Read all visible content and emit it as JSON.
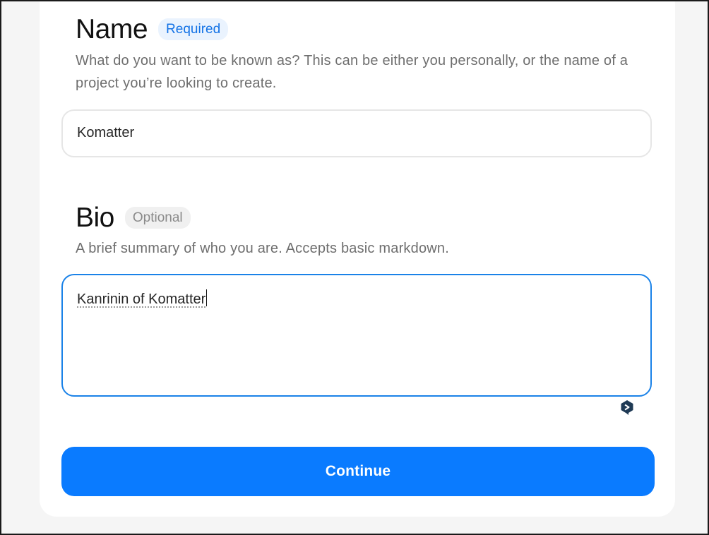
{
  "name_section": {
    "heading": "Name",
    "badge": "Required",
    "description": "What do you want to be known as? This can be either you personally, or the name of a project you’re looking to create.",
    "value": "Komatter"
  },
  "bio_section": {
    "heading": "Bio",
    "badge": "Optional",
    "description": "A brief summary of who you are. Accepts basic markdown.",
    "value": "Kanrinin of Komatter"
  },
  "continue_label": "Continue",
  "colors": {
    "accent": "#0a7bff",
    "focus_border": "#1a82e8",
    "required_text": "#1473e6",
    "optional_text": "#8a8a8a"
  },
  "icons": {
    "textarea_extension": "grammar-assistant-icon"
  }
}
